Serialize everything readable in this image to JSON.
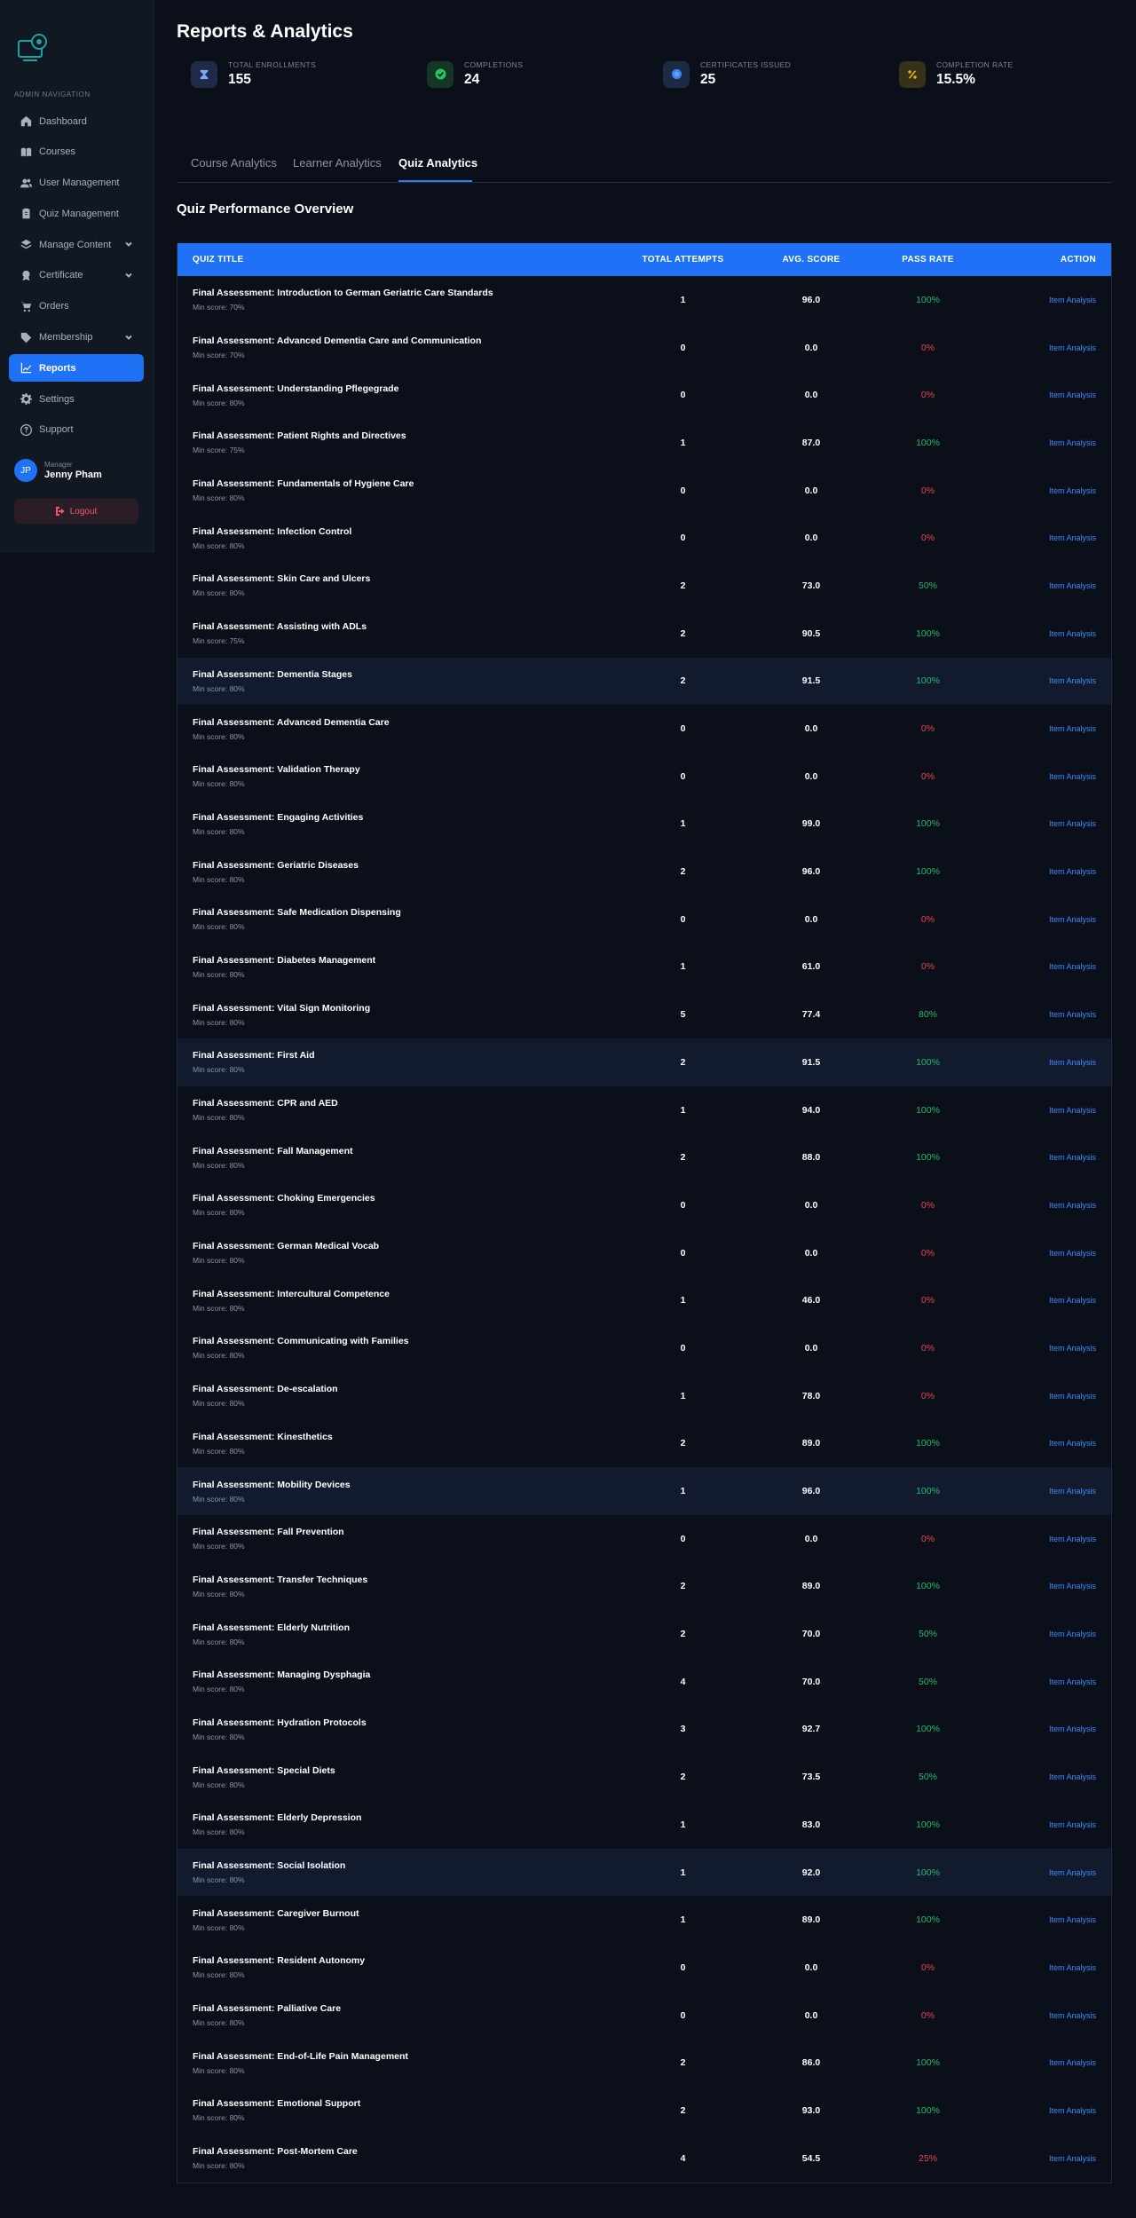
{
  "sidebar": {
    "heading": "ADMIN NAVIGATION",
    "items": [
      {
        "label": "Dashboard",
        "icon": "home-icon"
      },
      {
        "label": "Courses",
        "icon": "book-icon"
      },
      {
        "label": "User Management",
        "icon": "users-icon"
      },
      {
        "label": "Quiz Management",
        "icon": "clipboard-icon"
      },
      {
        "label": "Manage Content",
        "icon": "layers-icon"
      },
      {
        "label": "Certificate",
        "icon": "award-icon"
      },
      {
        "label": "Orders",
        "icon": "cart-icon"
      },
      {
        "label": "Membership",
        "icon": "tag-icon"
      },
      {
        "label": "Reports",
        "icon": "chart-line-icon"
      },
      {
        "label": "Settings",
        "icon": "gear-icon"
      },
      {
        "label": "Support",
        "icon": "help-icon"
      }
    ],
    "user": {
      "initials": "JP",
      "role": "Manager",
      "name": "Jenny Pham"
    },
    "logout_label": "Logout"
  },
  "header": {
    "title": "Reports & Analytics"
  },
  "stats": [
    {
      "label": "TOTAL ENROLLMENTS",
      "value": "155",
      "icon": "enrollment-icon",
      "color": "#3b82f6"
    },
    {
      "label": "COMPLETIONS",
      "value": "24",
      "icon": "check-circle-icon",
      "color": "#22c55e"
    },
    {
      "label": "CERTIFICATES ISSUED",
      "value": "25",
      "icon": "certificate-icon",
      "color": "#3b82f6"
    },
    {
      "label": "COMPLETION RATE",
      "value": "15.5%",
      "icon": "percent-icon",
      "color": "#eab308"
    }
  ],
  "tabs": [
    {
      "label": "Course Analytics"
    },
    {
      "label": "Learner Analytics"
    },
    {
      "label": "Quiz Analytics"
    }
  ],
  "section_title": "Quiz Performance Overview",
  "table": {
    "headers": {
      "title": "QUIZ TITLE",
      "attempts": "TOTAL ATTEMPTS",
      "score": "AVG. SCORE",
      "pass": "PASS RATE",
      "action": "ACTION"
    },
    "action_label": "Item Analysis",
    "rows": [
      {
        "title": "Final Assessment: Introduction to German Geriatric Care Standards",
        "min": "Min score: 70%",
        "attempts": "1",
        "score": "96.0",
        "pass": "100%"
      },
      {
        "title": "Final Assessment: Advanced Dementia Care and Communication",
        "min": "Min score: 70%",
        "attempts": "0",
        "score": "0.0",
        "pass": "0%"
      },
      {
        "title": "Final Assessment: Understanding Pflegegrade",
        "min": "Min score: 80%",
        "attempts": "0",
        "score": "0.0",
        "pass": "0%"
      },
      {
        "title": "Final Assessment: Patient Rights and Directives",
        "min": "Min score: 75%",
        "attempts": "1",
        "score": "87.0",
        "pass": "100%"
      },
      {
        "title": "Final Assessment: Fundamentals of Hygiene Care",
        "min": "Min score: 80%",
        "attempts": "0",
        "score": "0.0",
        "pass": "0%"
      },
      {
        "title": "Final Assessment: Infection Control",
        "min": "Min score: 80%",
        "attempts": "0",
        "score": "0.0",
        "pass": "0%"
      },
      {
        "title": "Final Assessment: Skin Care and Ulcers",
        "min": "Min score: 80%",
        "attempts": "2",
        "score": "73.0",
        "pass": "50%"
      },
      {
        "title": "Final Assessment: Assisting with ADLs",
        "min": "Min score: 75%",
        "attempts": "2",
        "score": "90.5",
        "pass": "100%"
      },
      {
        "title": "Final Assessment: Dementia Stages",
        "min": "Min score: 80%",
        "attempts": "2",
        "score": "91.5",
        "pass": "100%"
      },
      {
        "title": "Final Assessment: Advanced Dementia Care",
        "min": "Min score: 80%",
        "attempts": "0",
        "score": "0.0",
        "pass": "0%"
      },
      {
        "title": "Final Assessment: Validation Therapy",
        "min": "Min score: 80%",
        "attempts": "0",
        "score": "0.0",
        "pass": "0%"
      },
      {
        "title": "Final Assessment: Engaging Activities",
        "min": "Min score: 80%",
        "attempts": "1",
        "score": "99.0",
        "pass": "100%"
      },
      {
        "title": "Final Assessment: Geriatric Diseases",
        "min": "Min score: 80%",
        "attempts": "2",
        "score": "96.0",
        "pass": "100%"
      },
      {
        "title": "Final Assessment: Safe Medication Dispensing",
        "min": "Min score: 80%",
        "attempts": "0",
        "score": "0.0",
        "pass": "0%"
      },
      {
        "title": "Final Assessment: Diabetes Management",
        "min": "Min score: 80%",
        "attempts": "1",
        "score": "61.0",
        "pass": "0%"
      },
      {
        "title": "Final Assessment: Vital Sign Monitoring",
        "min": "Min score: 80%",
        "attempts": "5",
        "score": "77.4",
        "pass": "80%"
      },
      {
        "title": "Final Assessment: First Aid",
        "min": "Min score: 80%",
        "attempts": "2",
        "score": "91.5",
        "pass": "100%"
      },
      {
        "title": "Final Assessment: CPR and AED",
        "min": "Min score: 80%",
        "attempts": "1",
        "score": "94.0",
        "pass": "100%"
      },
      {
        "title": "Final Assessment: Fall Management",
        "min": "Min score: 80%",
        "attempts": "2",
        "score": "88.0",
        "pass": "100%"
      },
      {
        "title": "Final Assessment: Choking Emergencies",
        "min": "Min score: 80%",
        "attempts": "0",
        "score": "0.0",
        "pass": "0%"
      },
      {
        "title": "Final Assessment: German Medical Vocab",
        "min": "Min score: 80%",
        "attempts": "0",
        "score": "0.0",
        "pass": "0%"
      },
      {
        "title": "Final Assessment: Intercultural Competence",
        "min": "Min score: 80%",
        "attempts": "1",
        "score": "46.0",
        "pass": "0%"
      },
      {
        "title": "Final Assessment: Communicating with Families",
        "min": "Min score: 80%",
        "attempts": "0",
        "score": "0.0",
        "pass": "0%"
      },
      {
        "title": "Final Assessment: De-escalation",
        "min": "Min score: 80%",
        "attempts": "1",
        "score": "78.0",
        "pass": "0%"
      },
      {
        "title": "Final Assessment: Kinesthetics",
        "min": "Min score: 80%",
        "attempts": "2",
        "score": "89.0",
        "pass": "100%"
      },
      {
        "title": "Final Assessment: Mobility Devices",
        "min": "Min score: 80%",
        "attempts": "1",
        "score": "96.0",
        "pass": "100%"
      },
      {
        "title": "Final Assessment: Fall Prevention",
        "min": "Min score: 80%",
        "attempts": "0",
        "score": "0.0",
        "pass": "0%"
      },
      {
        "title": "Final Assessment: Transfer Techniques",
        "min": "Min score: 80%",
        "attempts": "2",
        "score": "89.0",
        "pass": "100%"
      },
      {
        "title": "Final Assessment: Elderly Nutrition",
        "min": "Min score: 80%",
        "attempts": "2",
        "score": "70.0",
        "pass": "50%"
      },
      {
        "title": "Final Assessment: Managing Dysphagia",
        "min": "Min score: 80%",
        "attempts": "4",
        "score": "70.0",
        "pass": "50%"
      },
      {
        "title": "Final Assessment: Hydration Protocols",
        "min": "Min score: 80%",
        "attempts": "3",
        "score": "92.7",
        "pass": "100%"
      },
      {
        "title": "Final Assessment: Special Diets",
        "min": "Min score: 80%",
        "attempts": "2",
        "score": "73.5",
        "pass": "50%"
      },
      {
        "title": "Final Assessment: Elderly Depression",
        "min": "Min score: 80%",
        "attempts": "1",
        "score": "83.0",
        "pass": "100%"
      },
      {
        "title": "Final Assessment: Social Isolation",
        "min": "Min score: 80%",
        "attempts": "1",
        "score": "92.0",
        "pass": "100%"
      },
      {
        "title": "Final Assessment: Caregiver Burnout",
        "min": "Min score: 80%",
        "attempts": "1",
        "score": "89.0",
        "pass": "100%"
      },
      {
        "title": "Final Assessment: Resident Autonomy",
        "min": "Min score: 80%",
        "attempts": "0",
        "score": "0.0",
        "pass": "0%"
      },
      {
        "title": "Final Assessment: Palliative Care",
        "min": "Min score: 80%",
        "attempts": "0",
        "score": "0.0",
        "pass": "0%"
      },
      {
        "title": "Final Assessment: End-of-Life Pain Management",
        "min": "Min score: 80%",
        "attempts": "2",
        "score": "86.0",
        "pass": "100%"
      },
      {
        "title": "Final Assessment: Emotional Support",
        "min": "Min score: 80%",
        "attempts": "2",
        "score": "93.0",
        "pass": "100%"
      },
      {
        "title": "Final Assessment: Post-Mortem Care",
        "min": "Min score: 80%",
        "attempts": "4",
        "score": "54.5",
        "pass": "25%"
      }
    ]
  },
  "colors": {
    "accent": "#1f72f6",
    "pass_ok": "#27b96b",
    "pass_bad": "#e5484d",
    "link": "#3a8bff",
    "background": "#0b0f1a",
    "sidebar": "#121821"
  }
}
